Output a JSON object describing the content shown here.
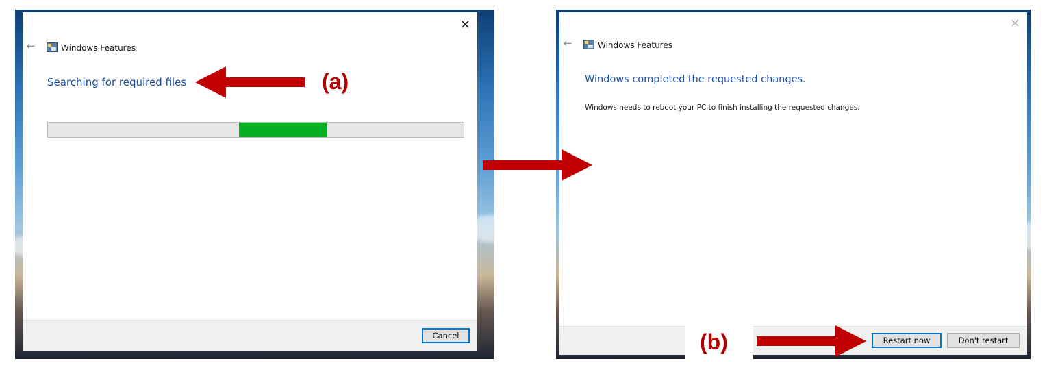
{
  "left_dialog": {
    "title": "Windows Features",
    "back_glyph": "←",
    "close_glyph": "✕",
    "heading": "Searching for required files",
    "progress": 0.21,
    "progress_color": "#06b025",
    "cancel_label": "Cancel"
  },
  "right_dialog": {
    "title": "Windows Features",
    "back_glyph": "←",
    "close_glyph": "✕",
    "heading": "Windows completed the requested changes.",
    "message": "Windows needs to reboot your PC to finish installing the requested changes.",
    "restart_label": "Restart now",
    "dont_restart_label": "Don't restart"
  },
  "annotations": {
    "a_label": "(a)",
    "b_label": "(b)",
    "arrow_color": "#c00000"
  }
}
